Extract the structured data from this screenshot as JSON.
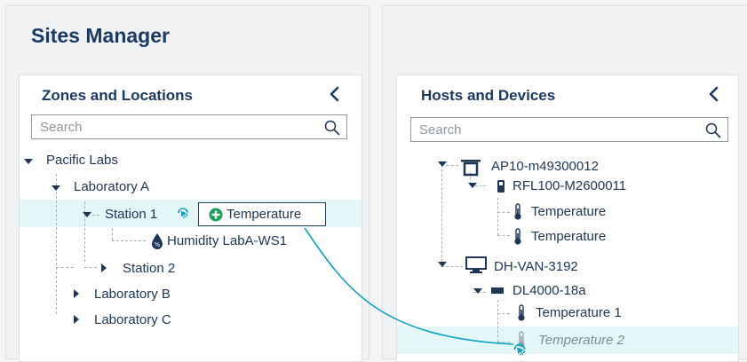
{
  "app": {
    "title": "Sites Manager"
  },
  "zones": {
    "title": "Zones and Locations",
    "search_placeholder": "Search",
    "tree": {
      "root": "Pacific Labs",
      "lab_a": "Laboratory A",
      "station1": "Station 1",
      "humidity": "Humidity LabA-WS1",
      "station2": "Station 2",
      "lab_b": "Laboratory B",
      "lab_c": "Laboratory C"
    },
    "drag_label": "Temperature"
  },
  "hosts": {
    "title": "Hosts and Devices",
    "search_placeholder": "Search",
    "tree": {
      "ap": "AP10-m49300012",
      "rfl": "RFL100-M2600011",
      "temp_a": "Temperature",
      "temp_b": "Temperature",
      "dh": "DH-VAN-3192",
      "dl": "DL4000-18a",
      "temp1": "Temperature 1",
      "temp2": "Temperature 2"
    }
  },
  "colors": {
    "accent": "#0aa3c2",
    "title": "#1b3a63",
    "highlight": "#e3f7f9",
    "add_green": "#1aa05a"
  }
}
